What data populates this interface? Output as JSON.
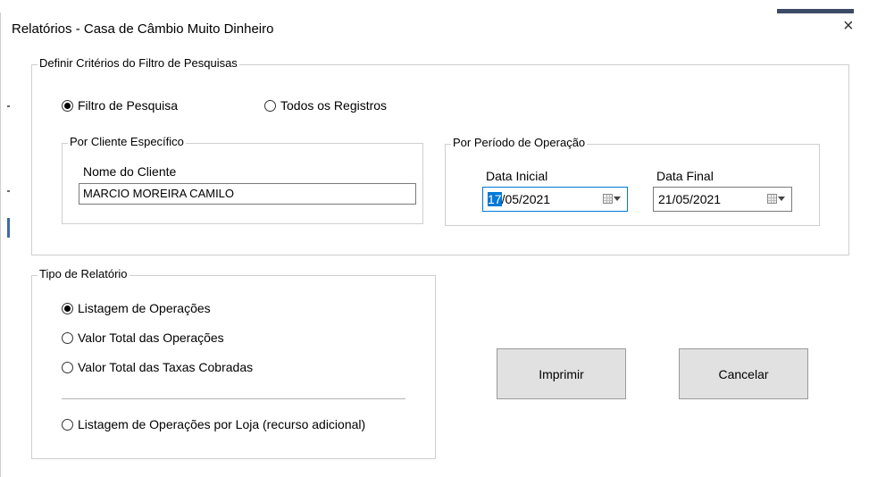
{
  "window": {
    "title": "Relatórios - Casa de Câmbio Muito Dinheiro",
    "close_glyph": "×"
  },
  "criteria": {
    "legend": "Definir Critérios do Filtro de Pesquisas",
    "options": [
      {
        "label": "Filtro de Pesquisa",
        "selected": true
      },
      {
        "label": "Todos os Registros",
        "selected": false
      }
    ]
  },
  "client": {
    "legend": "Por Cliente Específico",
    "field_label": "Nome do Cliente",
    "field_value": "MARCIO MOREIRA CAMILO"
  },
  "period": {
    "legend": "Por Período de Operação",
    "start_label": "Data Inicial",
    "start_value_selected": "17",
    "start_value_rest": "/05/2021",
    "end_label": "Data Final",
    "end_value": "21/05/2021"
  },
  "report_type": {
    "legend": "Tipo de Relatório",
    "options": [
      {
        "label": "Listagem de Operações",
        "selected": true
      },
      {
        "label": "Valor Total das Operações",
        "selected": false
      },
      {
        "label": "Valor Total das Taxas Cobradas",
        "selected": false
      },
      {
        "label": "Listagem de Operações por Loja (recurso adicional)",
        "selected": false
      }
    ]
  },
  "actions": {
    "print_label": "Imprimir",
    "cancel_label": "Cancelar"
  },
  "colors": {
    "selection": "#0078d7",
    "button_face": "#e1e1e1"
  }
}
